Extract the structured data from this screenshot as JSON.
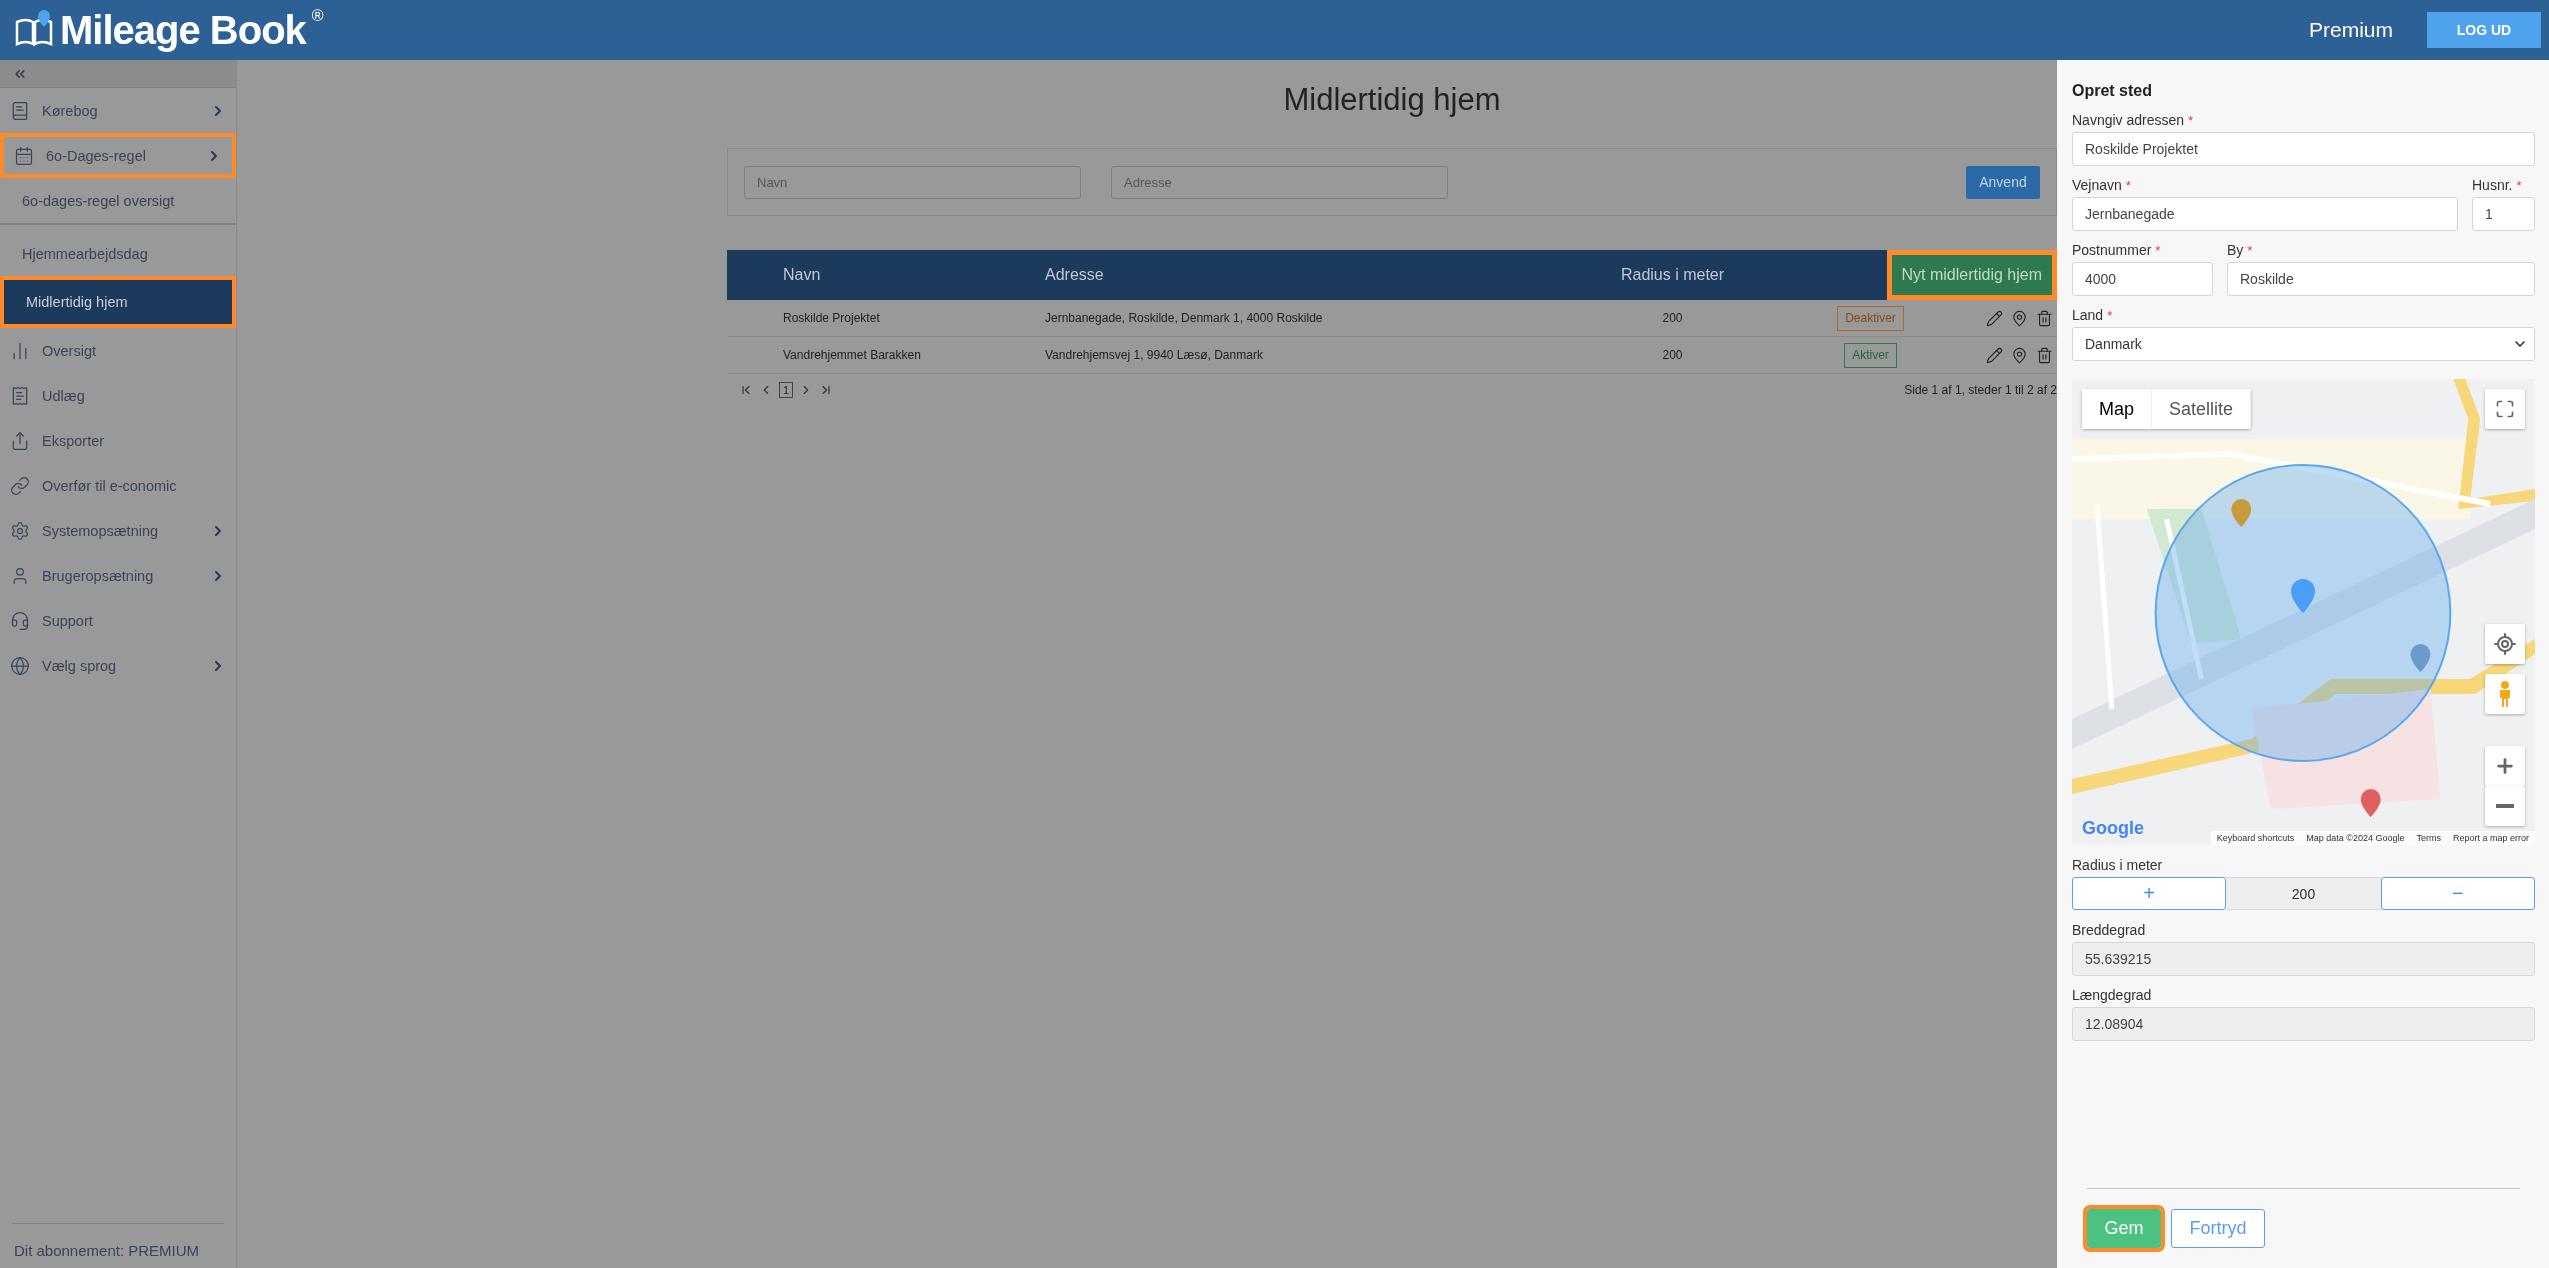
{
  "header": {
    "logo": "Mileage Book",
    "logo_mark": "®",
    "plan": "Premium",
    "logout": "LOG UD"
  },
  "sidebar": {
    "items": [
      {
        "label": "Kørebog",
        "expandable": true,
        "selected": false,
        "highlighted": false
      },
      {
        "label": "6o-Dages-regel",
        "expandable": true,
        "selected": false,
        "highlighted": true,
        "children": [
          {
            "label": "6o-dages-regel oversigt",
            "selected": false,
            "highlighted": false
          },
          {
            "label": "Hjemmearbejdsdag",
            "selected": false,
            "highlighted": false
          },
          {
            "label": "Midlertidig hjem",
            "selected": true,
            "highlighted": true
          }
        ]
      },
      {
        "label": "Oversigt",
        "expandable": false,
        "selected": false,
        "highlighted": false
      },
      {
        "label": "Udlæg",
        "expandable": false,
        "selected": false,
        "highlighted": false
      },
      {
        "label": "Eksporter",
        "expandable": false,
        "selected": false,
        "highlighted": false
      },
      {
        "label": "Overfør til e-conomic",
        "expandable": false,
        "selected": false,
        "highlighted": false
      },
      {
        "label": "Systemopsætning",
        "expandable": true,
        "selected": false,
        "highlighted": false
      },
      {
        "label": "Brugeropsætning",
        "expandable": true,
        "selected": false,
        "highlighted": false
      },
      {
        "label": "Support",
        "expandable": false,
        "selected": false,
        "highlighted": false
      },
      {
        "label": "Vælg sprog",
        "expandable": true,
        "selected": false,
        "highlighted": false
      }
    ],
    "subscription": "Dit abonnement: PREMIUM"
  },
  "main": {
    "title": "Midlertidig hjem",
    "filters": [
      {
        "placeholder": "Navn"
      },
      {
        "placeholder": "Adresse"
      }
    ],
    "apply": "Anvend",
    "table": {
      "columns": [
        "Navn",
        "Adresse",
        "Radius i meter"
      ],
      "new_button": {
        "label": "Nyt midlertidig hjem",
        "highlighted": true
      },
      "rows": [
        {
          "name": "Roskilde Projektet",
          "address": "Jernbanegade, Roskilde, Denmark 1, 4000 Roskilde",
          "radius": "200",
          "toggle": {
            "kind": "deactivate",
            "label": "Deaktiver"
          }
        },
        {
          "name": "Vandrehjemmet Barakken",
          "address": "Vandrehjemsvej 1, 9940 Læsø, Danmark",
          "radius": "200",
          "toggle": {
            "kind": "activate",
            "label": "Aktiver"
          }
        }
      ],
      "pagination": {
        "page": "1",
        "info": "Side 1 af 1, steder 1 til 2 af 2"
      }
    }
  },
  "panel": {
    "title": "Opret sted",
    "name": {
      "label": "Navngiv adressen",
      "required_mark": "*",
      "value": "Roskilde Projektet"
    },
    "street": {
      "label": "Vejnavn",
      "required_mark": "*",
      "value": "Jernbanegade"
    },
    "house_no": {
      "label": "Husnr.",
      "required_mark": "*",
      "value": "1"
    },
    "postcode": {
      "label": "Postnummer",
      "required_mark": "*",
      "value": "4000"
    },
    "city": {
      "label": "By",
      "required_mark": "*",
      "value": "Roskilde"
    },
    "country": {
      "label": "Land",
      "required_mark": "*",
      "value": "Danmark"
    },
    "map": {
      "kind": "picture",
      "map_types": [
        {
          "label": "Map",
          "selected": true
        },
        {
          "label": "Satellite",
          "selected": false
        }
      ],
      "logo": "Google",
      "footer": [
        "Keyboard shortcuts",
        "Map data ©2024 Google",
        "Terms",
        "Report a map error"
      ]
    },
    "radius": {
      "label": "Radius i meter",
      "plus": "+",
      "value": "200",
      "minus": "−"
    },
    "latitude": {
      "label": "Breddegrad",
      "value": "55.639215"
    },
    "longitude": {
      "label": "Længdegrad",
      "value": "12.08904"
    },
    "save": {
      "label": "Gem",
      "highlighted": true
    },
    "cancel": {
      "label": "Fortryd"
    }
  }
}
